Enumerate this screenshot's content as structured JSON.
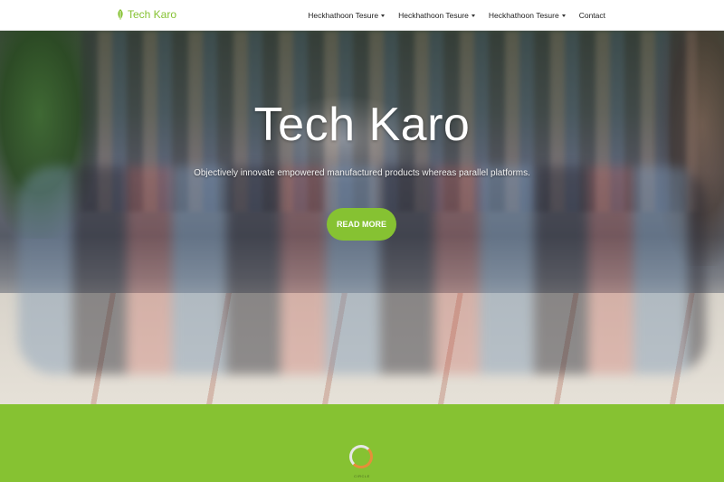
{
  "navbar": {
    "brand": "Tech Karo",
    "items": [
      {
        "label": "Heckhathoon Tesure",
        "dropdown": true
      },
      {
        "label": "Heckhathoon Tesure",
        "dropdown": true
      },
      {
        "label": "Heckhathoon Tesure",
        "dropdown": true
      },
      {
        "label": "Contact",
        "dropdown": false
      }
    ]
  },
  "hero": {
    "title": "Tech Karo",
    "subtitle": "Objectively innovate empowered manufactured products whereas parallel platforms.",
    "button": "READ MORE"
  },
  "loader": {
    "label": "CIRCLE"
  },
  "colors": {
    "accent": "#86c232",
    "loader_arc": "#e58f3a"
  },
  "icons": {
    "brand": "leaf-icon",
    "dropdown": "caret-down-icon"
  }
}
